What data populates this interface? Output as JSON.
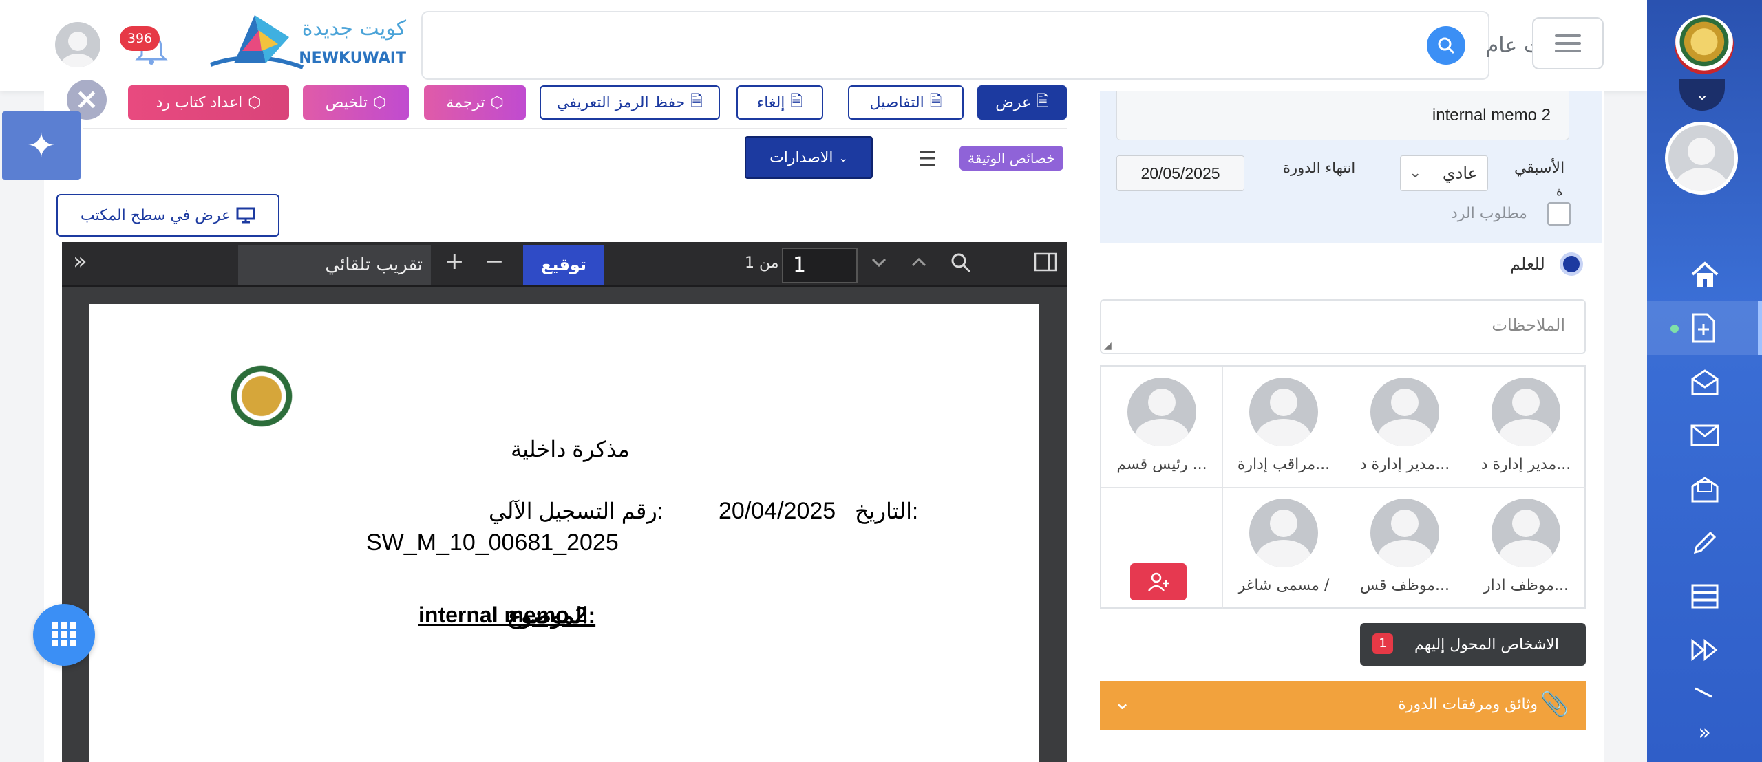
{
  "header": {
    "search_placeholder": "بحث عام",
    "notifications_count": "396",
    "logo_arabic": "كويت جديدة",
    "logo_english": "NEWKUWAIT"
  },
  "toolbar": {
    "view": "عرض",
    "details": "التفاصيل",
    "cancel": "إلغاء",
    "save_code": "حفظ الرمز التعريفي",
    "translate": "ترجمة",
    "summarize": "تلخيص",
    "prepare_reply": "اعداد كتاب رد"
  },
  "document_bar": {
    "doc_properties": "خصائص الوثيقة",
    "versions": "الاصدارات",
    "open_desktop": "عرض في سطح المكتب"
  },
  "pdf_viewer": {
    "page_number": "1",
    "page_of": "من 1",
    "sign": "توقيع",
    "zoom": "تقريب تلقائي"
  },
  "document": {
    "title": "مذكرة داخلية",
    "date_label": "التاريخ:",
    "date": "20/04/2025",
    "registration_label": "رقم التسجيل الآلي:",
    "registration_no": "SW_M_10_00681_2025",
    "subject_label": "الموضوع:",
    "subject": "internal memo 2"
  },
  "details_panel": {
    "memo_title": "internal memo 2",
    "priority_label": "الأسبقي",
    "priority_label_wrap": "ة",
    "priority_value": "عادي",
    "cycle_end_label": "انتهاء الدورة",
    "cycle_end_date": "20/05/2025",
    "reply_required": "مطلوب الرد",
    "fyi": "للعلم",
    "notes_placeholder": "الملاحظات"
  },
  "recipients": [
    "مدير إدارة د...",
    "مدير إدارة د...",
    "مراقب إدارة...",
    "رئيس قسم ...",
    "موظف ادار...",
    "موظف قس...",
    "مسمى شاغر /"
  ],
  "transferred": {
    "label": "الاشخاص المحول إليهم",
    "count": "1"
  },
  "attachments": {
    "label": "وثائق ومرفقات الدورة"
  },
  "colors": {
    "primary": "#1c3aa0",
    "sidebar": "#2f5ec8",
    "accent_orange": "#f2a23d",
    "badge_red": "#e63946",
    "purple_badge": "#8f63d8"
  }
}
